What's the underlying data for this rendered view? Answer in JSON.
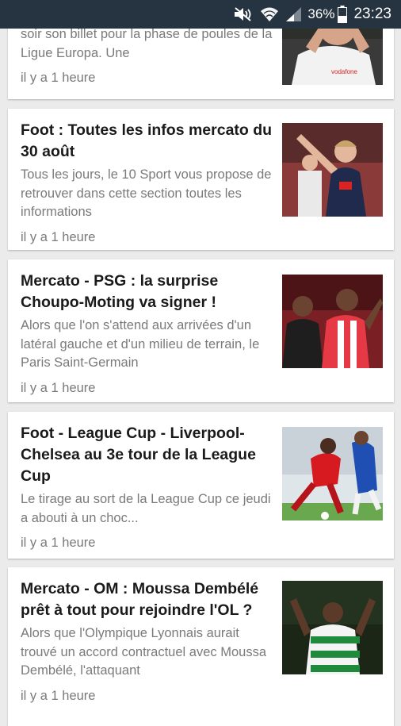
{
  "status_bar": {
    "battery_percent": "36%",
    "time": "23:23",
    "icons": [
      "mute-icon",
      "wifi-icon",
      "signal-icon",
      "battery-icon"
    ]
  },
  "articles": [
    {
      "title": "",
      "summary": "soir son billet pour la phase de poules de la Ligue Europa. Une",
      "time": "il y a 1 heure",
      "image": "besiktas-player-photo"
    },
    {
      "title": "Foot : Toutes les infos mercato du 30 août",
      "summary": "Tous les jours, le 10 Sport vous propose de retrouver dans cette section toutes les informations",
      "time": "il y a 1 heure",
      "image": "croatia-player-photo"
    },
    {
      "title": "Mercato - PSG : la surprise Choupo-Moting va signer !",
      "summary": "Alors que l'on s'attend aux arrivées d'un latéral gauche et d'un milieu de terrain, le Paris Saint-Germain",
      "time": "il y a 1 heure",
      "image": "stoke-player-photo"
    },
    {
      "title": "Foot - League Cup - Liverpool-Chelsea au 3e tour de la League Cup",
      "summary": "Le tirage au sort de la League Cup ce jeudi a abouti à un choc...",
      "time": "il y a 1 heure",
      "image": "liverpool-chelsea-photo"
    },
    {
      "title": "Mercato - OM : Moussa Dembélé prêt à tout pour rejoindre l'OL ?",
      "summary": "Alors que l'Olympique Lyonnais aurait trouvé un accord contractuel avec Moussa Dembélé, l'attaquant",
      "time": "il y a 1 heure",
      "image": "celtic-player-photo"
    }
  ]
}
